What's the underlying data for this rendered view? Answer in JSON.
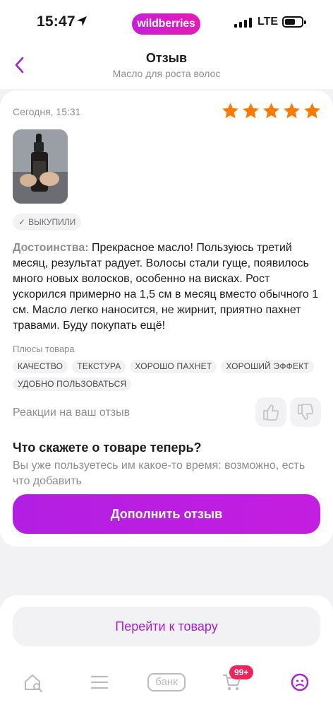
{
  "status_bar": {
    "time": "15:47",
    "brand": "wildberries",
    "network": "LTE"
  },
  "header": {
    "title": "Отзыв",
    "subtitle": "Масло для роста волос"
  },
  "review": {
    "date": "Сегодня, 15:31",
    "rating": 5,
    "badge": "ВЫКУПИЛИ",
    "pros_label": "Достоинства:",
    "pros_text": " Прекрасное масло! Пользуюсь третий месяц, результат радует. Волосы стали гуще, появилось много новых волосков, особенно на висках. Рост ускорился примерно на 1,5 см в месяц вместо обычного 1 см. Масло легко наносится, не жирнит, приятно пахнет травами. Буду покупать ещё!",
    "plus_label": "Плюсы товара",
    "tags": [
      "КАЧЕСТВО",
      "ТЕКСТУРА",
      "ХОРОШО ПАХНЕТ",
      "ХОРОШИЙ ЭФФЕКТ",
      "УДОБНО ПОЛЬЗОВАТЬСЯ"
    ],
    "reactions_label": "Реакции на ваш отзыв"
  },
  "followup": {
    "title": "Что скажете о товаре теперь?",
    "text": "Вы уже пользуетесь им какое-то время: возможно, есть что добавить",
    "button": "Дополнить отзыв"
  },
  "goto_button": "Перейти к товару",
  "tabbar": {
    "bank_label": "банк",
    "cart_badge": "99+"
  },
  "colors": {
    "accent": "#b21fe2",
    "star": "#ff7a00",
    "badge": "#f0245a"
  }
}
